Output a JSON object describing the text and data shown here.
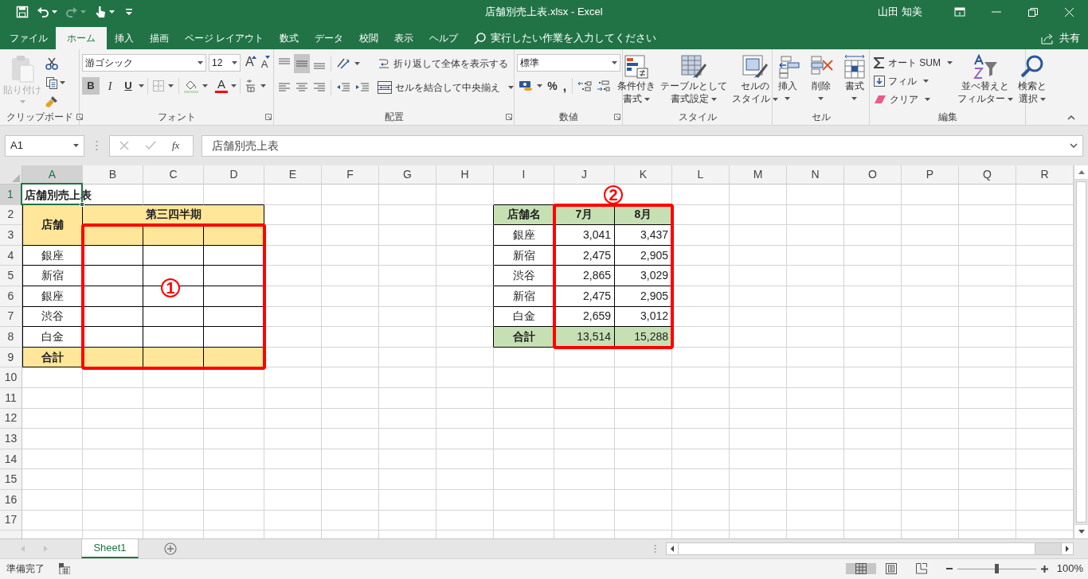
{
  "window": {
    "title": "店舗別売上表.xlsx  -  Excel",
    "user": "山田 知美"
  },
  "tabs": [
    {
      "label": "ファイル",
      "selected": false
    },
    {
      "label": "ホーム",
      "selected": true
    },
    {
      "label": "挿入",
      "selected": false
    },
    {
      "label": "描画",
      "selected": false
    },
    {
      "label": "ページ レイアウト",
      "selected": false
    },
    {
      "label": "数式",
      "selected": false
    },
    {
      "label": "データ",
      "selected": false
    },
    {
      "label": "校閲",
      "selected": false
    },
    {
      "label": "表示",
      "selected": false
    },
    {
      "label": "ヘルプ",
      "selected": false
    }
  ],
  "tell_me": {
    "placeholder": "実行したい作業を入力してください"
  },
  "share": "共有",
  "ribbon": {
    "clipboard": {
      "label": "クリップボード",
      "paste": "貼り付け",
      "paste_disabled": true
    },
    "font": {
      "label": "フォント",
      "font_name": "游ゴシック",
      "font_size": "12",
      "grow": "A",
      "shrink": "A",
      "bold": "B",
      "italic": "I",
      "underline": "U",
      "font_color": "A",
      "bold_on": true
    },
    "alignment": {
      "label": "配置",
      "middle_on": true,
      "wrap_text": "折り返して全体を表示する",
      "merge_center": "セルを結合して中央揃え"
    },
    "number": {
      "label": "数値",
      "format": "標準",
      "percent": "%",
      "comma": ","
    },
    "styles": {
      "label": "スタイル",
      "buttons": [
        {
          "lines": [
            "条件付き",
            "書式"
          ]
        },
        {
          "lines": [
            "テーブルとして",
            "書式設定"
          ]
        },
        {
          "lines": [
            "セルの",
            "スタイル"
          ]
        }
      ]
    },
    "cells": {
      "label": "セル",
      "buttons": [
        {
          "lines": [
            "挿入"
          ]
        },
        {
          "lines": [
            "削除"
          ]
        },
        {
          "lines": [
            "書式"
          ]
        }
      ]
    },
    "editing": {
      "label": "編集",
      "autosum": "オート SUM",
      "fill": "フィル",
      "clear": "クリア",
      "buttons": [
        {
          "lines": [
            "並べ替えと",
            "フィルター"
          ]
        },
        {
          "lines": [
            "検索と",
            "選択"
          ]
        }
      ]
    }
  },
  "formula_bar": {
    "name_box": "A1",
    "function_label": "fx",
    "formula": "店舗別売上表"
  },
  "sheet": {
    "columns": [
      {
        "label": "A",
        "selected": true
      },
      {
        "label": "B",
        "selected": false
      },
      {
        "label": "C",
        "selected": false
      },
      {
        "label": "D",
        "selected": false
      },
      {
        "label": "E",
        "selected": false
      },
      {
        "label": "F",
        "selected": false
      },
      {
        "label": "G",
        "selected": false
      },
      {
        "label": "H",
        "selected": false
      },
      {
        "label": "I",
        "selected": false
      },
      {
        "label": "J",
        "selected": false
      },
      {
        "label": "K",
        "selected": false
      },
      {
        "label": "L",
        "selected": false
      },
      {
        "label": "M",
        "selected": false
      },
      {
        "label": "N",
        "selected": false
      },
      {
        "label": "O",
        "selected": false
      },
      {
        "label": "P",
        "selected": false
      },
      {
        "label": "Q",
        "selected": false
      },
      {
        "label": "R",
        "selected": false
      }
    ],
    "rows": [
      {
        "number": "1",
        "selected": true,
        "cells": [
          {
            "kind": "title",
            "text": "店舗別売上表",
            "selected": true
          },
          null,
          null,
          null,
          null,
          null,
          null,
          null,
          null,
          null,
          null,
          null,
          null,
          null,
          null,
          null,
          null,
          null
        ]
      },
      {
        "number": "2",
        "selected": false,
        "cells": [
          {
            "kind": "header",
            "text": "店舗",
            "color": "#ffe699",
            "selected": false,
            "rowspan": 2
          },
          {
            "kind": "header",
            "text": "第三四半期",
            "color": "#ffe699",
            "selected": false,
            "colspan": 3
          },
          null,
          null,
          null,
          null,
          {
            "kind": "header",
            "text": "店舗名",
            "color": "#c6e0b4",
            "selected": false
          },
          {
            "kind": "header",
            "text": "7月",
            "color": "#c6e0b4",
            "selected": false
          },
          {
            "kind": "header",
            "text": "8月",
            "color": "#c6e0b4",
            "selected": false
          },
          null,
          null,
          null,
          null,
          null,
          null,
          null
        ]
      },
      {
        "number": "3",
        "selected": false,
        "cells": [
          {
            "kind": "blank",
            "color": "#ffe699",
            "selected": false
          },
          {
            "kind": "blank",
            "color": "#ffe699",
            "selected": false
          },
          {
            "kind": "blank",
            "color": "#ffe699",
            "selected": false
          },
          null,
          null,
          null,
          null,
          {
            "kind": "label",
            "text": "銀座",
            "selected": false
          },
          {
            "kind": "number",
            "text": "3,041",
            "selected": false
          },
          {
            "kind": "number",
            "text": "3,437",
            "selected": false
          },
          null,
          null,
          null,
          null,
          null,
          null,
          null
        ]
      },
      {
        "number": "4",
        "selected": false,
        "cells": [
          {
            "kind": "label",
            "text": "銀座",
            "selected": false
          },
          {
            "kind": "blank",
            "selected": false
          },
          {
            "kind": "blank",
            "selected": false
          },
          {
            "kind": "blank",
            "selected": false
          },
          null,
          null,
          null,
          null,
          {
            "kind": "label",
            "text": "新宿",
            "selected": false
          },
          {
            "kind": "number",
            "text": "2,475",
            "selected": false
          },
          {
            "kind": "number",
            "text": "2,905",
            "selected": false
          },
          null,
          null,
          null,
          null,
          null,
          null,
          null
        ]
      },
      {
        "number": "5",
        "selected": false,
        "cells": [
          {
            "kind": "label",
            "text": "新宿",
            "selected": false
          },
          {
            "kind": "blank",
            "selected": false
          },
          {
            "kind": "blank",
            "selected": false
          },
          {
            "kind": "blank",
            "selected": false
          },
          null,
          null,
          null,
          null,
          {
            "kind": "label",
            "text": "渋谷",
            "selected": false
          },
          {
            "kind": "number",
            "text": "2,865",
            "selected": false
          },
          {
            "kind": "number",
            "text": "3,029",
            "selected": false
          },
          null,
          null,
          null,
          null,
          null,
          null,
          null
        ]
      },
      {
        "number": "6",
        "selected": false,
        "cells": [
          {
            "kind": "label",
            "text": "銀座",
            "selected": false
          },
          {
            "kind": "blank",
            "selected": false
          },
          {
            "kind": "blank",
            "selected": false
          },
          {
            "kind": "blank",
            "selected": false
          },
          null,
          null,
          null,
          null,
          {
            "kind": "label",
            "text": "新宿",
            "selected": false
          },
          {
            "kind": "number",
            "text": "2,475",
            "selected": false
          },
          {
            "kind": "number",
            "text": "2,905",
            "selected": false
          },
          null,
          null,
          null,
          null,
          null,
          null,
          null
        ]
      },
      {
        "number": "7",
        "selected": false,
        "cells": [
          {
            "kind": "label",
            "text": "渋谷",
            "selected": false
          },
          {
            "kind": "blank",
            "selected": false
          },
          {
            "kind": "blank",
            "selected": false
          },
          {
            "kind": "blank",
            "selected": false
          },
          null,
          null,
          null,
          null,
          {
            "kind": "label",
            "text": "白金",
            "selected": false
          },
          {
            "kind": "number",
            "text": "2,659",
            "selected": false
          },
          {
            "kind": "number",
            "text": "3,012",
            "selected": false
          },
          null,
          null,
          null,
          null,
          null,
          null,
          null
        ]
      },
      {
        "number": "8",
        "selected": false,
        "cells": [
          {
            "kind": "label",
            "text": "白金",
            "selected": false
          },
          {
            "kind": "blank",
            "selected": false
          },
          {
            "kind": "blank",
            "selected": false
          },
          {
            "kind": "blank",
            "selected": false
          },
          null,
          null,
          null,
          null,
          {
            "kind": "header",
            "text": "合計",
            "color": "#c6e0b4",
            "selected": false
          },
          {
            "kind": "number",
            "text": "13,514",
            "color": "#c6e0b4",
            "selected": false
          },
          {
            "kind": "number",
            "text": "15,288",
            "color": "#c6e0b4",
            "selected": false
          },
          null,
          null,
          null,
          null,
          null,
          null,
          null
        ]
      },
      {
        "number": "9",
        "selected": false,
        "cells": [
          {
            "kind": "header",
            "text": "合計",
            "color": "#ffe699",
            "selected": false
          },
          {
            "kind": "blank",
            "color": "#ffe699",
            "selected": false
          },
          {
            "kind": "blank",
            "color": "#ffe699",
            "selected": false
          },
          {
            "kind": "blank",
            "color": "#ffe699",
            "selected": false
          },
          null,
          null,
          null,
          null,
          null,
          null,
          null,
          null,
          null,
          null,
          null,
          null,
          null,
          null
        ]
      },
      {
        "number": "10",
        "selected": false,
        "cells": [
          null,
          null,
          null,
          null,
          null,
          null,
          null,
          null,
          null,
          null,
          null,
          null,
          null,
          null,
          null,
          null,
          null,
          null
        ]
      },
      {
        "number": "11",
        "selected": false,
        "cells": [
          null,
          null,
          null,
          null,
          null,
          null,
          null,
          null,
          null,
          null,
          null,
          null,
          null,
          null,
          null,
          null,
          null,
          null
        ]
      },
      {
        "number": "12",
        "selected": false,
        "cells": [
          null,
          null,
          null,
          null,
          null,
          null,
          null,
          null,
          null,
          null,
          null,
          null,
          null,
          null,
          null,
          null,
          null,
          null
        ]
      },
      {
        "number": "13",
        "selected": false,
        "cells": [
          null,
          null,
          null,
          null,
          null,
          null,
          null,
          null,
          null,
          null,
          null,
          null,
          null,
          null,
          null,
          null,
          null,
          null
        ]
      },
      {
        "number": "14",
        "selected": false,
        "cells": [
          null,
          null,
          null,
          null,
          null,
          null,
          null,
          null,
          null,
          null,
          null,
          null,
          null,
          null,
          null,
          null,
          null,
          null
        ]
      },
      {
        "number": "15",
        "selected": false,
        "cells": [
          null,
          null,
          null,
          null,
          null,
          null,
          null,
          null,
          null,
          null,
          null,
          null,
          null,
          null,
          null,
          null,
          null,
          null
        ]
      },
      {
        "number": "16",
        "selected": false,
        "cells": [
          null,
          null,
          null,
          null,
          null,
          null,
          null,
          null,
          null,
          null,
          null,
          null,
          null,
          null,
          null,
          null,
          null,
          null
        ]
      },
      {
        "number": "17",
        "selected": false,
        "cells": [
          null,
          null,
          null,
          null,
          null,
          null,
          null,
          null,
          null,
          null,
          null,
          null,
          null,
          null,
          null,
          null,
          null,
          null
        ]
      }
    ]
  },
  "annotations": [
    {
      "label": "1"
    },
    {
      "label": "2"
    }
  ],
  "sheet_tabs": [
    {
      "label": "Sheet1",
      "selected": true
    }
  ],
  "status_bar": {
    "status": "準備完了",
    "view_modes": [
      {
        "kind": "normal",
        "selected": true
      },
      {
        "kind": "page_layout",
        "selected": false
      },
      {
        "kind": "page_break",
        "selected": false
      }
    ],
    "zoom": {
      "level": 0.5,
      "reading": "100%"
    }
  }
}
